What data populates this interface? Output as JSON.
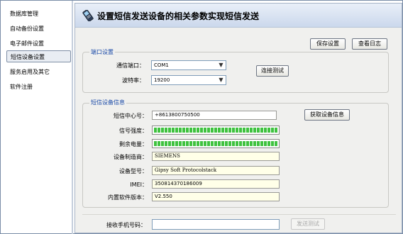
{
  "sidebar": {
    "items": [
      {
        "label": "数据库管理",
        "active": false
      },
      {
        "label": "自动备份设置",
        "active": false
      },
      {
        "label": "电子邮件设置",
        "active": false
      },
      {
        "label": "短信设备设置",
        "active": true
      },
      {
        "label": "服务启用及其它",
        "active": false
      },
      {
        "label": "软件注册",
        "active": false
      }
    ]
  },
  "header": {
    "icon": "mobile-phone-icon",
    "title": "设置短信发送设备的相关参数实现短信发送"
  },
  "toolbar": {
    "save_label": "保存设置",
    "log_label": "查看日志"
  },
  "port_settings": {
    "title": "端口设置",
    "port_label": "通信端口：",
    "port_value": "COM1",
    "baud_label": "波特率：",
    "baud_value": "19200",
    "connect_label": "连接测试"
  },
  "device_info": {
    "title": "短信设备信息",
    "sms_center_label": "短信中心号：",
    "sms_center_value": "+8613800750500",
    "get_info_label": "获取设备信息",
    "signal_label": "信号强度：",
    "signal_level": 1.0,
    "battery_label": "剩余电量：",
    "battery_level": 1.0,
    "manufacturer_label": "设备制造商：",
    "manufacturer_value": "SIEMENS",
    "model_label": "设备型号：",
    "model_value": "Gipsy Soft Protocolstack",
    "imei_label": "IMEI：",
    "imei_value": "350814370186009",
    "firmware_label": "内置软件版本：",
    "firmware_value": "V2.550"
  },
  "send_test": {
    "phone_label": "接收手机号码：",
    "phone_value": "",
    "send_label": "发送测试"
  },
  "colors": {
    "group_title": "#1a4aa8",
    "signal_bar": "#3fc23f",
    "field_bg": "#ffffe8"
  }
}
